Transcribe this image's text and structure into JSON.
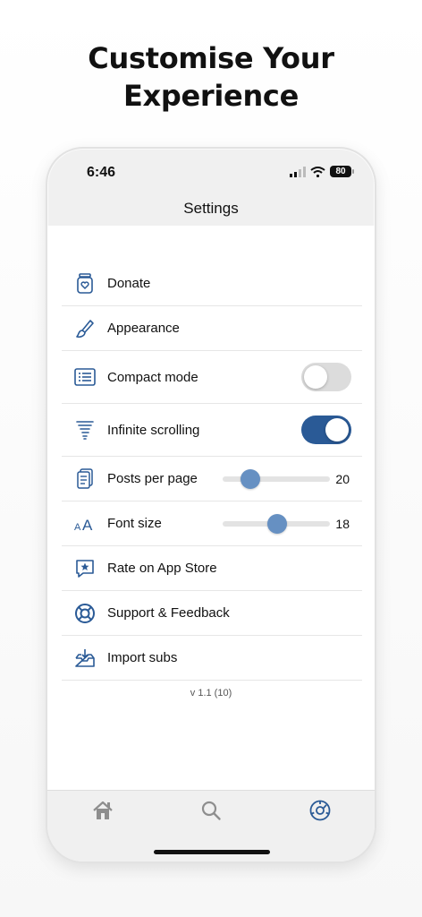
{
  "headline": {
    "line1": "Customise Your",
    "line2": "Experience"
  },
  "status_bar": {
    "time": "6:46",
    "battery": "80"
  },
  "nav": {
    "title": "Settings"
  },
  "settings": {
    "donate": "Donate",
    "appearance": "Appearance",
    "compact_mode": {
      "label": "Compact mode",
      "enabled": false
    },
    "infinite_scrolling": {
      "label": "Infinite scrolling",
      "enabled": true
    },
    "posts_per_page": {
      "label": "Posts per page",
      "value": "20",
      "fraction": 0.26
    },
    "font_size": {
      "label": "Font size",
      "value": "18",
      "fraction": 0.51
    },
    "rate": "Rate on App Store",
    "support": "Support & Feedback",
    "import": "Import subs"
  },
  "version": "v 1.1 (10)",
  "tabs": [
    {
      "name": "home-icon",
      "active": false
    },
    {
      "name": "search-icon",
      "active": false
    },
    {
      "name": "settings-icon",
      "active": true
    }
  ],
  "colors": {
    "accent": "#2a5a96",
    "slider_thumb": "#6690c2",
    "inactive_icon": "#8e8e8e"
  }
}
